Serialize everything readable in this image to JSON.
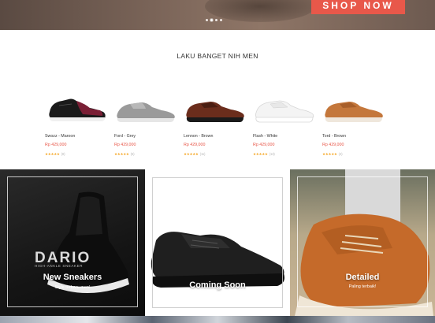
{
  "hero": {
    "cta_label": "SHOP NOW",
    "slides_count": 4,
    "active_slide": 2,
    "accent_color": "#e8584a"
  },
  "section": {
    "title": "LAKU BANGET NIH MEN"
  },
  "products": [
    {
      "name": "Swozz - Maroon",
      "price": "Rp 429,000",
      "stars": "★★★★★",
      "count": "(8)",
      "color": "#7a1f35",
      "image": "sneaker-black-maroon"
    },
    {
      "name": "Ford - Grey",
      "price": "Rp 429,000",
      "stars": "★★★★★",
      "count": "(5)",
      "color": "#9a9a9a",
      "image": "sneaker-grey"
    },
    {
      "name": "Lennon - Brown",
      "price": "Rp 429,000",
      "stars": "★★★★★",
      "count": "(11)",
      "color": "#6b2d1c",
      "image": "sneaker-brown-dark"
    },
    {
      "name": "Flash - White",
      "price": "Rp 429,000",
      "stars": "★★★★★",
      "count": "(13)",
      "color": "#f2f2f2",
      "image": "sneaker-white"
    },
    {
      "name": "Tord - Brown",
      "price": "Rp 429,000",
      "stars": "★★★★★",
      "count": "(4)",
      "color": "#c4773b",
      "image": "sneaker-tan"
    }
  ],
  "tiles": [
    {
      "brand": "DARIO",
      "brand_sub": "HIGH-ANKLE SNEAKER",
      "title": "New Sneakers",
      "subtitle": "Style terbaru men!"
    },
    {
      "title": "Coming Soon"
    },
    {
      "title": "Detailed",
      "subtitle": "Paling terbaik!"
    }
  ]
}
